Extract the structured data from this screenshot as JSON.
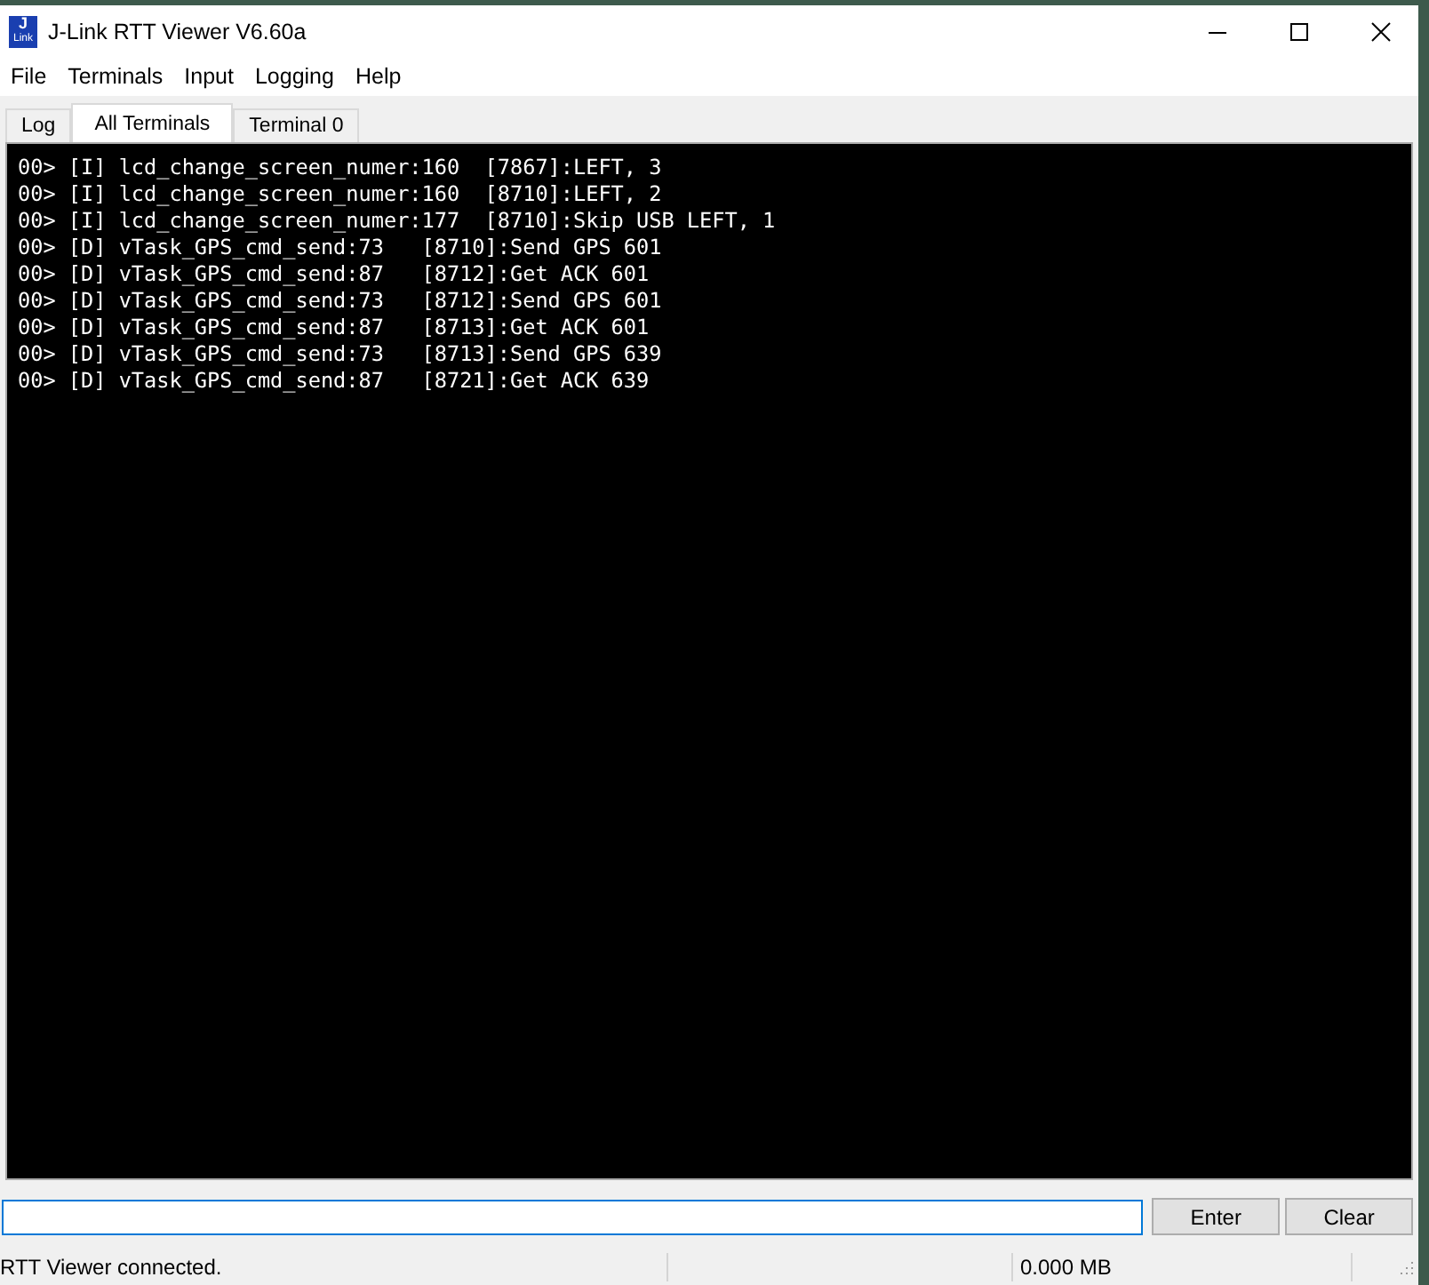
{
  "window": {
    "title": "J-Link RTT Viewer V6.60a",
    "logo_text": "J Link"
  },
  "menu": [
    "File",
    "Terminals",
    "Input",
    "Logging",
    "Help"
  ],
  "tabs": [
    {
      "label": "Log",
      "selected": false
    },
    {
      "label": "All Terminals",
      "selected": true
    },
    {
      "label": "Terminal 0",
      "selected": false
    }
  ],
  "terminal_lines": [
    "00> [I] lcd_change_screen_numer:160  [7867]:LEFT, 3",
    "00> [I] lcd_change_screen_numer:160  [8710]:LEFT, 2",
    "00> [I] lcd_change_screen_numer:177  [8710]:Skip USB LEFT, 1",
    "00> [D] vTask_GPS_cmd_send:73   [8710]:Send GPS 601",
    "00> [D] vTask_GPS_cmd_send:87   [8712]:Get ACK 601",
    "00> [D] vTask_GPS_cmd_send:73   [8712]:Send GPS 601",
    "00> [D] vTask_GPS_cmd_send:87   [8713]:Get ACK 601",
    "00> [D] vTask_GPS_cmd_send:73   [8713]:Send GPS 639",
    "00> [D] vTask_GPS_cmd_send:87   [8721]:Get ACK 639"
  ],
  "input": {
    "buttons": [
      "Enter",
      "Clear"
    ]
  },
  "status_bar": {
    "message": "RTT Viewer connected.",
    "size": "0.000 MB"
  }
}
